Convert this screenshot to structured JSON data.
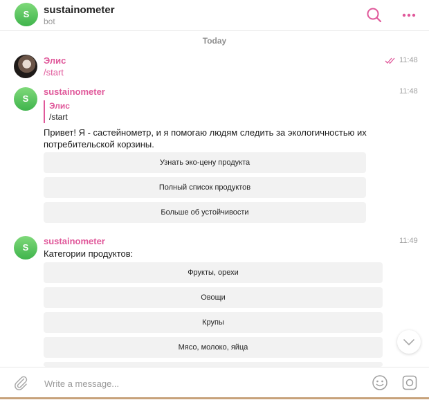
{
  "header": {
    "avatar_letter": "S",
    "title": "sustainometer",
    "subtitle": "bot"
  },
  "date_separator": "Today",
  "messages": [
    {
      "sender": "Элис",
      "text": "/start",
      "time": "11:48"
    },
    {
      "sender": "sustainometer",
      "avatar_letter": "S",
      "time": "11:48",
      "reply_to": {
        "name": "Элис",
        "text": "/start"
      },
      "text_lines": [
        "Привет! Я - састейнометр, и я помогаю людям следить за экологичностью их",
        "потребительской корзины."
      ],
      "buttons": [
        "Узнать эко-цену продукта",
        "Полный список продуктов",
        "Больше об устойчивости"
      ]
    },
    {
      "sender": "sustainometer",
      "avatar_letter": "S",
      "time": "11:49",
      "text": "Категории продуктов:",
      "buttons": [
        "Фрукты, орехи",
        "Овощи",
        "Крупы",
        "Мясо, молоко, яйца"
      ]
    }
  ],
  "composer": {
    "placeholder": "Write a message..."
  },
  "colors": {
    "accent": "#e0589a",
    "bot_avatar": "#4cbb56"
  }
}
